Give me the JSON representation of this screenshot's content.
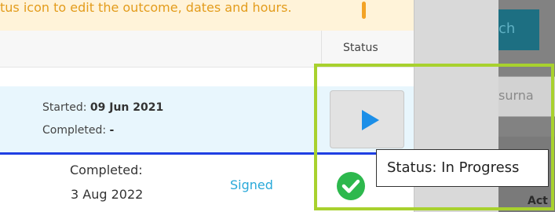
{
  "notice": {
    "text": "tus icon to edit the outcome, dates and hours."
  },
  "table": {
    "status_header": "Status",
    "rows": [
      {
        "started_label": "Started:",
        "started_value": "09 Jun 2021",
        "completed_label": "Completed:",
        "completed_value": "-",
        "status": "In Progress"
      },
      {
        "completed_label": "Completed:",
        "completed_date": "3 Aug 2022",
        "link": "Signed",
        "status": "Complete"
      }
    ]
  },
  "tooltip": {
    "text": "Status: In Progress"
  },
  "right_panel": {
    "search_button": "ch",
    "surname_placeholder": "surna",
    "section_label": "Act"
  },
  "colors": {
    "highlight_frame": "#a8d12e",
    "play_icon": "#1c8fe8",
    "complete_icon": "#2db84d",
    "link": "#29a9d9",
    "row_separator": "#1f3fe3"
  }
}
